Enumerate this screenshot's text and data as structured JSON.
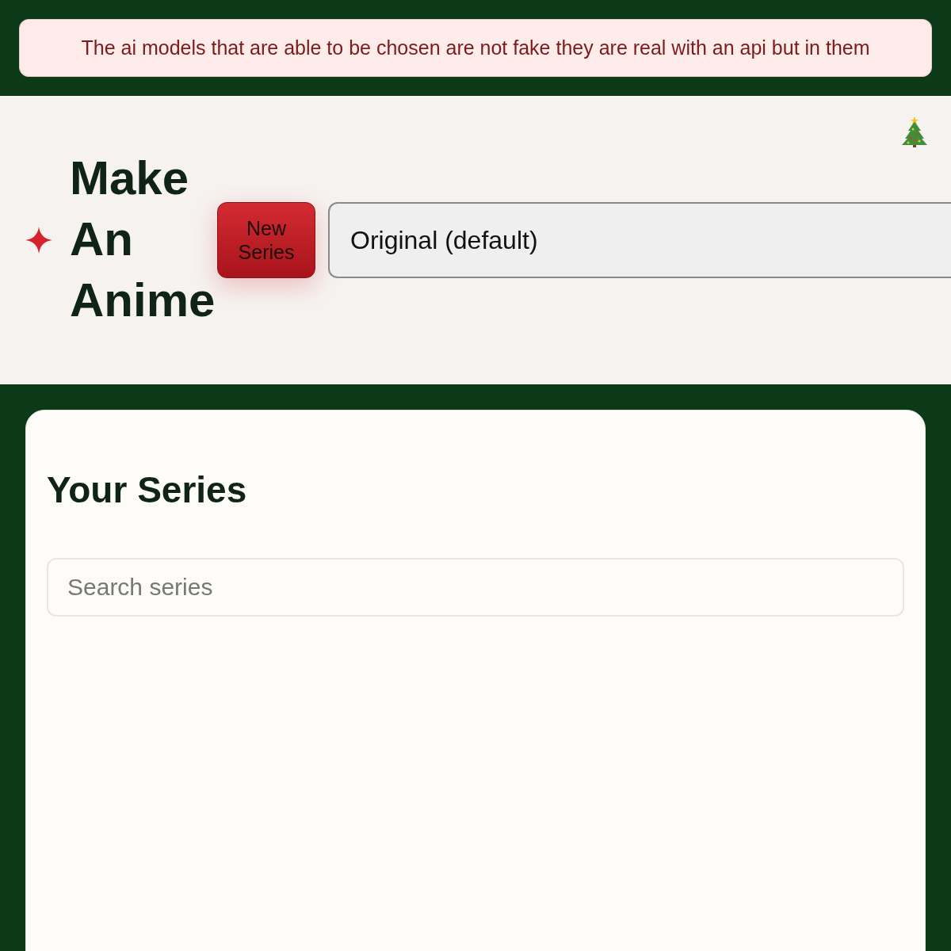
{
  "notice": {
    "text": "The ai models that are able to be chosen are not fake they are real with an api but in them"
  },
  "header": {
    "title": "Make An Anime",
    "new_button": "New Series",
    "model_select": {
      "value": "Original (default)"
    }
  },
  "series_panel": {
    "heading": "Your Series",
    "search": {
      "placeholder": "Search series"
    }
  }
}
